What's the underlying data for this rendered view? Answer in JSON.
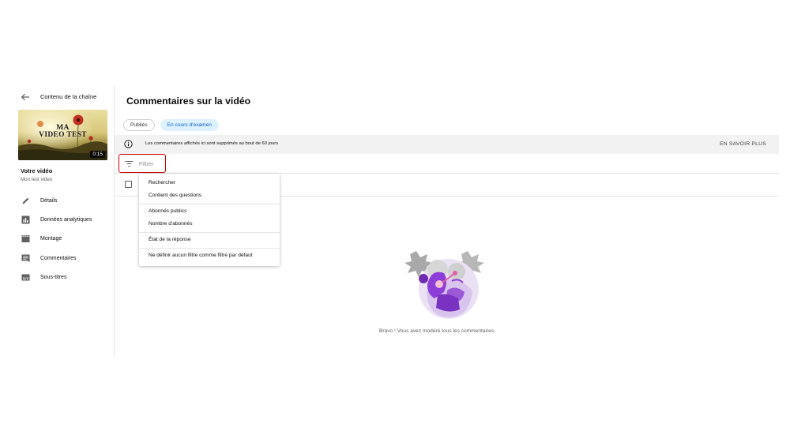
{
  "sidebar": {
    "back_label": "Contenu de la chaîne",
    "thumbnail": {
      "title_line1": "MA",
      "title_line2": "VIDEO TEST",
      "duration": "0:15"
    },
    "video_section_label": "Votre vidéo",
    "video_name": "Mon test video",
    "items": [
      {
        "label": "Détails",
        "icon": "pencil-icon"
      },
      {
        "label": "Données analytiques",
        "icon": "analytics-icon"
      },
      {
        "label": "Montage",
        "icon": "clapperboard-icon"
      },
      {
        "label": "Commentaires",
        "icon": "comment-icon"
      },
      {
        "label": "Sous-titres",
        "icon": "subtitles-icon"
      }
    ]
  },
  "main": {
    "title": "Commentaires sur la vidéo",
    "tabs": [
      {
        "label": "Publiés",
        "selected": false
      },
      {
        "label": "En cours d'examen",
        "selected": true
      }
    ],
    "banner": {
      "text": "Les commentaires affichés ici sont supprimés au bout de 60 jours",
      "link": "EN SAVOIR PLUS"
    },
    "filter": {
      "placeholder": "Filtrer"
    },
    "filter_menu": {
      "groups": [
        [
          "Rechercher",
          "Contient des questions"
        ],
        [
          "Abonnés publics",
          "Nombre d'abonnés"
        ],
        [
          "État de la réponse"
        ],
        [
          "Ne définir aucun filtre comme filtre par défaut"
        ]
      ]
    },
    "empty_state": {
      "message": "Bravo ! Vous avez modéré tous les commentaires."
    }
  },
  "colors": {
    "accent_blue": "#065fd4",
    "chip_selected_bg": "#def1ff",
    "filter_border": "#cc0000",
    "illustration_purple": "#8e3ed8"
  }
}
